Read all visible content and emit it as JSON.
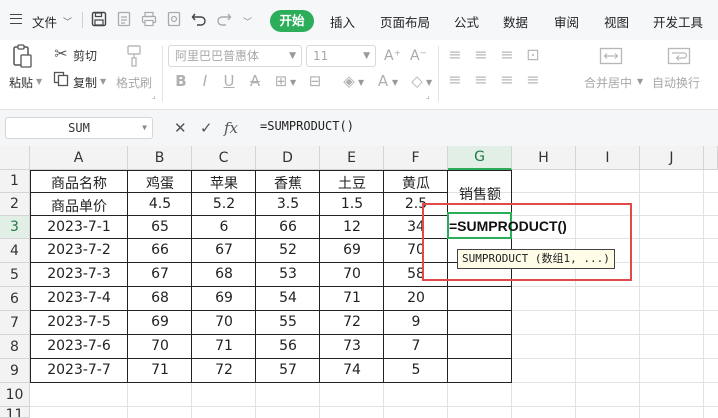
{
  "menubar": {
    "file_label": "文件",
    "tabs": [
      "开始",
      "插入",
      "页面布局",
      "公式",
      "数据",
      "审阅",
      "视图",
      "开发工具"
    ],
    "active_tab": "开始"
  },
  "ribbon": {
    "paste": "粘贴",
    "cut": "剪切",
    "copy": "复制",
    "format_painter": "格式刷",
    "font_name": "阿里巴巴普惠体",
    "font_size": "11",
    "merge_center": "合并居中",
    "wrap_text": "自动换行"
  },
  "formula_bar": {
    "name_box": "SUM",
    "fx_label": "fx",
    "formula": "=SUMPRODUCT()"
  },
  "sheet": {
    "columns": [
      "A",
      "B",
      "C",
      "D",
      "E",
      "F",
      "G",
      "H",
      "I",
      "J"
    ],
    "rows": [
      "1",
      "2",
      "3",
      "4",
      "5",
      "6",
      "7",
      "8",
      "9",
      "10",
      "11"
    ],
    "table": [
      [
        "商品名称",
        "鸡蛋",
        "苹果",
        "香蕉",
        "土豆",
        "黄瓜",
        "销售额"
      ],
      [
        "商品单价",
        "4.5",
        "5.2",
        "3.5",
        "1.5",
        "2.5",
        ""
      ],
      [
        "2023-7-1",
        "65",
        "6",
        "66",
        "12",
        "34",
        ""
      ],
      [
        "2023-7-2",
        "66",
        "67",
        "52",
        "69",
        "70",
        ""
      ],
      [
        "2023-7-3",
        "67",
        "68",
        "53",
        "70",
        "58",
        ""
      ],
      [
        "2023-7-4",
        "68",
        "69",
        "54",
        "71",
        "20",
        ""
      ],
      [
        "2023-7-5",
        "69",
        "70",
        "55",
        "72",
        "9",
        ""
      ],
      [
        "2023-7-6",
        "70",
        "71",
        "56",
        "73",
        "7",
        ""
      ],
      [
        "2023-7-7",
        "71",
        "72",
        "57",
        "74",
        "5",
        ""
      ]
    ],
    "active_cell": "G3",
    "edit_text": "=SUMPRODUCT()",
    "tooltip": "SUMPRODUCT (数组1, ...)"
  },
  "colors": {
    "accent": "#2bad5a",
    "highlight": "#e04a4a"
  }
}
